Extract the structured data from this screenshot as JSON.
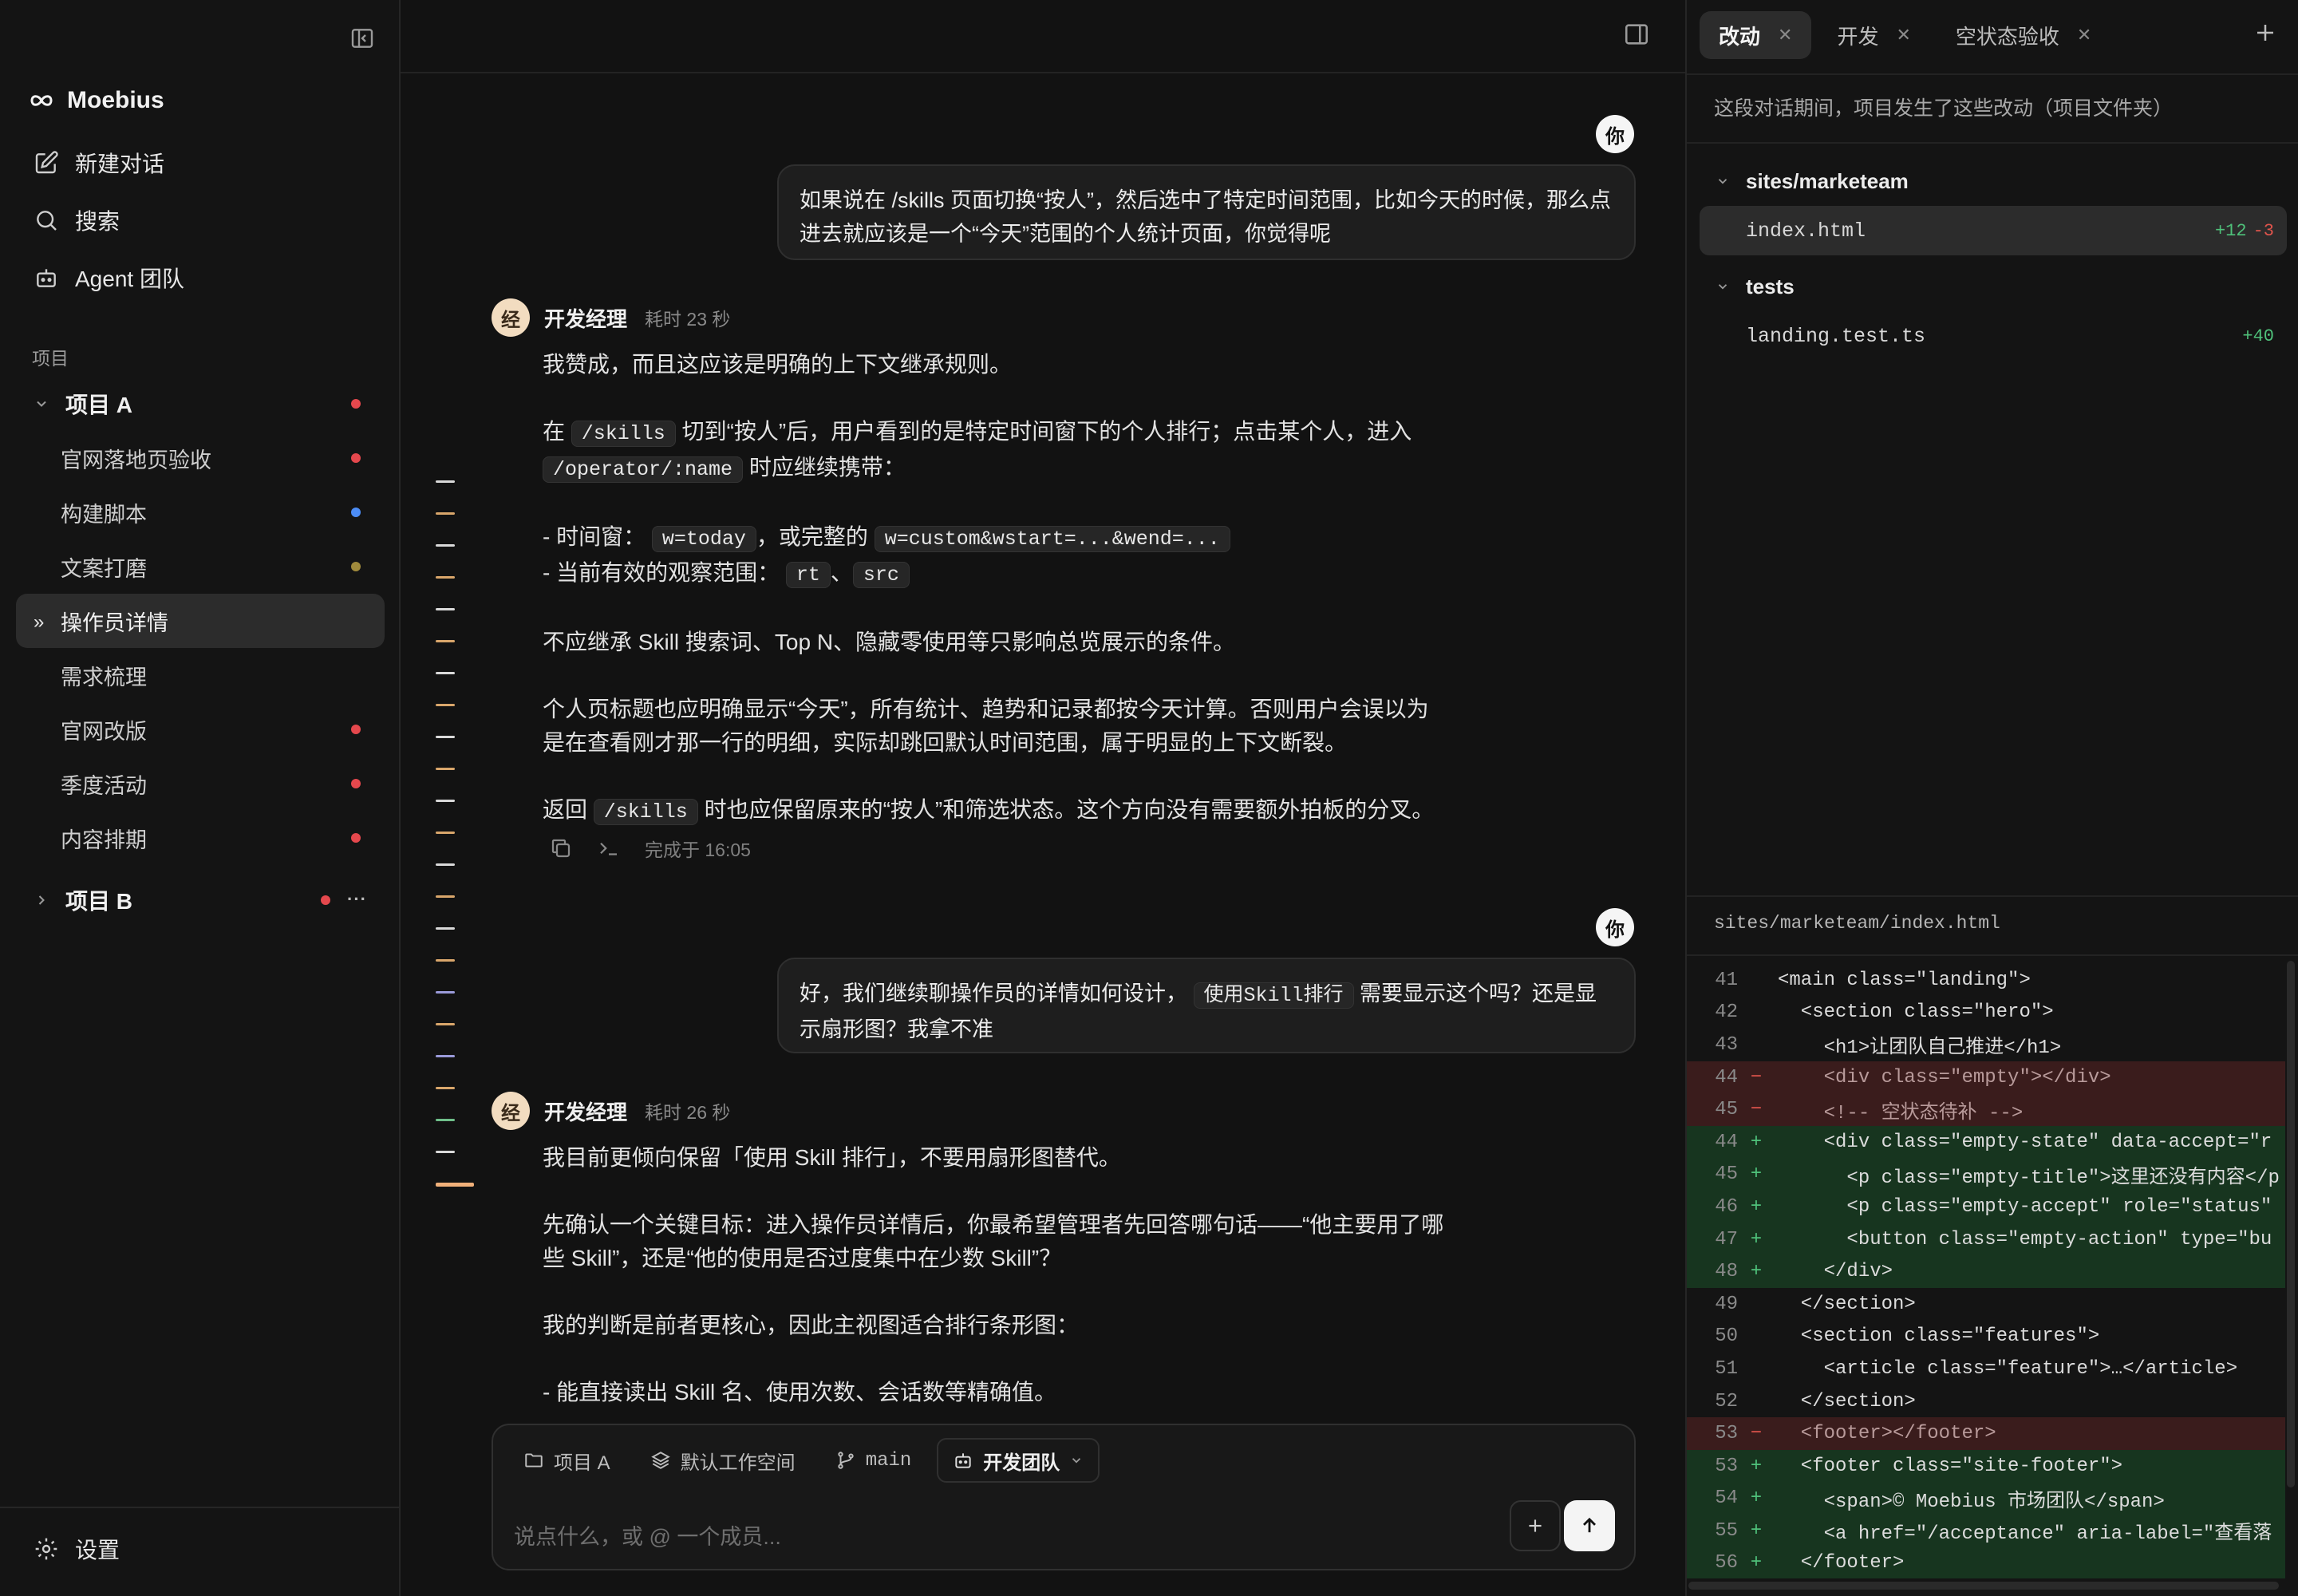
{
  "app": {
    "name": "Moebius"
  },
  "nav": {
    "new_chat": "新建对话",
    "search": "搜索",
    "agent_team": "Agent 团队"
  },
  "projects_title": "项目",
  "project_a": {
    "label": "项目 A",
    "items": [
      {
        "label": "官网落地页验收",
        "dot": "#e5484d"
      },
      {
        "label": "构建脚本",
        "dot": "#4c8df6"
      },
      {
        "label": "文案打磨",
        "dot": "#a08a3c"
      },
      {
        "label": "操作员详情",
        "dot": ""
      },
      {
        "label": "需求梳理",
        "dot": ""
      },
      {
        "label": "官网改版",
        "dot": "#e5484d"
      },
      {
        "label": "季度活动",
        "dot": "#e5484d"
      },
      {
        "label": "内容排期",
        "dot": "#e5484d"
      }
    ]
  },
  "project_b": {
    "label": "项目 B"
  },
  "settings": "设置",
  "chat": {
    "you_label": "你",
    "agent_initial": "经",
    "user_msg_1": "如果说在 /skills 页面切换“按人”，然后选中了特定时间范围，比如今天的时候，那么点进去就应该是一个“今天”范围的个人统计页面，你觉得呢",
    "agent_name": "开发经理",
    "agent_time_1": "耗时 23 秒",
    "r1_p1": "我赞成，而且这应该是明确的上下文继承规则。",
    "r1_p2a": "在",
    "r1_code_skills": "/skills",
    "r1_p2b": "切到“按人”后，用户看到的是特定时间窗下的个人排行；点击某个人，进入",
    "r1_code_operator": "/operator/:name",
    "r1_p2c": "时应继续携带：",
    "r1_l1a": "- 时间窗：",
    "r1_code_today": "w=today",
    "r1_l1b": "，或完整的",
    "r1_code_custom": "w=custom&wstart=...&wend=...",
    "r1_l2a": "- 当前有效的观察范围：",
    "r1_code_rt": "rt",
    "r1_l2b": "、",
    "r1_code_src": "src",
    "r1_p3": "不应继承 Skill 搜索词、Top N、隐藏零使用等只影响总览展示的条件。",
    "r1_p4": "个人页标题也应明确显示“今天”，所有统计、趋势和记录都按今天计算。否则用户会误以为是在查看刚才那一行的明细，实际却跳回默认时间范围，属于明显的上下文断裂。",
    "r1_p5a": "返回",
    "r1_code_skills2": "/skills",
    "r1_p5b": "时也应保留原来的“按人”和筛选状态。这个方向没有需要额外拍板的分叉。",
    "done_at": "完成于 16:05",
    "user_msg_2a": "好，我们继续聊操作员的详情如何设计，",
    "user_msg_2_code": "使用Skill排行",
    "user_msg_2b": "需要显示这个吗？还是显示扇形图？我拿不准",
    "agent_time_2": "耗时 26 秒",
    "r2_p1": "我目前更倾向保留「使用 Skill 排行」，不要用扇形图替代。",
    "r2_p2": "先确认一个关键目标：进入操作员详情后，你最希望管理者先回答哪句话——“他主要用了哪些 Skill”，还是“他的使用是否过度集中在少数 Skill”？",
    "r2_p3": "我的判断是前者更核心，因此主视图适合排行条形图：",
    "r2_p4": "- 能直接读出 Skill 名、使用次数、会话数等精确值。"
  },
  "composer": {
    "project": "项目 A",
    "workspace": "默认工作空间",
    "branch": "main",
    "team": "开发团队",
    "placeholder": "说点什么，或 @ 一个成员..."
  },
  "right_panel": {
    "tabs": [
      "改动",
      "开发",
      "空状态验收"
    ],
    "description": "这段对话期间，项目发生了这些改动（项目文件夹）",
    "folders": [
      {
        "name": "sites/marketeam",
        "files": [
          {
            "name": "index.html",
            "add": "+12",
            "del": "-3"
          }
        ]
      },
      {
        "name": "tests",
        "files": [
          {
            "name": "landing.test.ts",
            "add": "+40",
            "del": ""
          }
        ]
      }
    ],
    "diff_path": "sites/marketeam/index.html",
    "diff_lines": [
      {
        "n": "41",
        "t": "ctx",
        "code": "<main class=\"landing\">"
      },
      {
        "n": "42",
        "t": "ctx",
        "code": "  <section class=\"hero\">"
      },
      {
        "n": "43",
        "t": "ctx",
        "code": "    <h1>让团队自己推进</h1>"
      },
      {
        "n": "44",
        "t": "del",
        "code": "    <div class=\"empty\"></div>"
      },
      {
        "n": "45",
        "t": "del",
        "code": "    <!-- 空状态待补 -->"
      },
      {
        "n": "44",
        "t": "add",
        "code": "    <div class=\"empty-state\" data-accept=\"r"
      },
      {
        "n": "45",
        "t": "add",
        "code": "      <p class=\"empty-title\">这里还没有内容</p"
      },
      {
        "n": "46",
        "t": "add",
        "code": "      <p class=\"empty-accept\" role=\"status\""
      },
      {
        "n": "47",
        "t": "add",
        "code": "      <button class=\"empty-action\" type=\"bu"
      },
      {
        "n": "48",
        "t": "add",
        "code": "    </div>"
      },
      {
        "n": "49",
        "t": "ctx",
        "code": "  </section>"
      },
      {
        "n": "50",
        "t": "ctx",
        "code": "  <section class=\"features\">"
      },
      {
        "n": "51",
        "t": "ctx",
        "code": "    <article class=\"feature\">…</article>"
      },
      {
        "n": "52",
        "t": "ctx",
        "code": "  </section>"
      },
      {
        "n": "53",
        "t": "del",
        "code": "  <footer></footer>"
      },
      {
        "n": "53",
        "t": "add",
        "code": "  <footer class=\"site-footer\">"
      },
      {
        "n": "54",
        "t": "add",
        "code": "    <span>© Moebius 市场团队</span>"
      },
      {
        "n": "55",
        "t": "add",
        "code": "    <a href=\"/acceptance\" aria-label=\"查看落"
      },
      {
        "n": "56",
        "t": "add",
        "code": "  </footer>"
      }
    ]
  },
  "timeline_colors": [
    "#d9d9d9",
    "#d9a66b",
    "#d9d9d9",
    "#d9a66b",
    "#d9d9d9",
    "#d9a66b",
    "#d9d9d9",
    "#d9a66b",
    "#d9d9d9",
    "#d9a66b",
    "#d9d9d9",
    "#d9a66b",
    "#d9d9d9",
    "#d9a66b",
    "#d9d9d9",
    "#d9a66b",
    "#9a9ad9",
    "#d9a66b",
    "#9a9ad9",
    "#d9a66b",
    "#6fbf8a",
    "#d9d9d9",
    "#f0b07a"
  ]
}
